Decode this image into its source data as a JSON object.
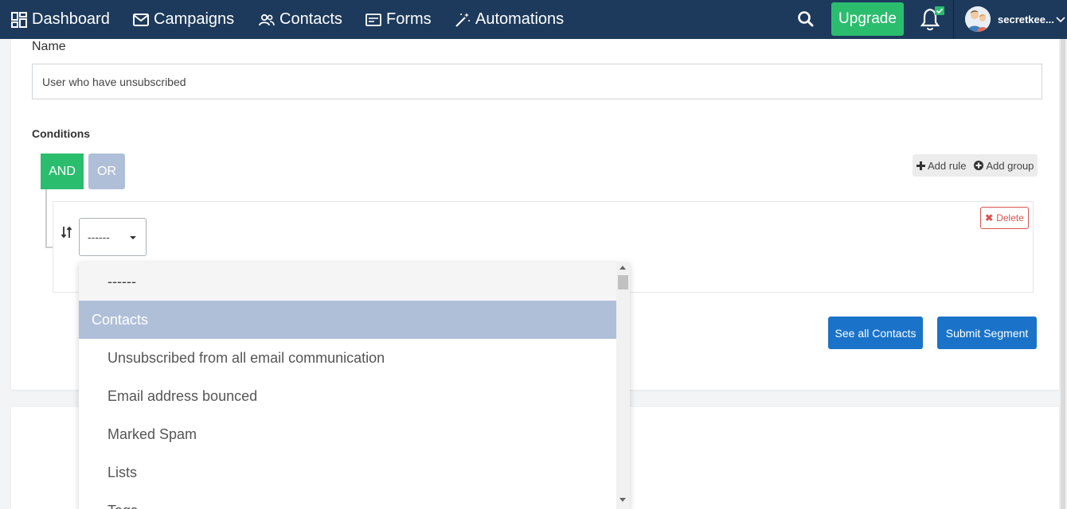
{
  "colors": {
    "nav_bg": "#1d3a5c",
    "upgrade_bg": "#2bbd6e",
    "and_bg": "#2bbd6e",
    "or_bg": "#b0bfd8",
    "primary_button": "#1a73c9",
    "delete_red": "#d9534f",
    "dropdown_group_bg": "#b0bfd8"
  },
  "nav": {
    "items": [
      {
        "label": "Dashboard",
        "icon": "dashboard-icon"
      },
      {
        "label": "Campaigns",
        "icon": "envelope-icon"
      },
      {
        "label": "Contacts",
        "icon": "contacts-icon"
      },
      {
        "label": "Forms",
        "icon": "forms-icon"
      },
      {
        "label": "Automations",
        "icon": "magic-wand-icon"
      }
    ],
    "upgrade_label": "Upgrade",
    "user_name": "secretkee..."
  },
  "form": {
    "name_label": "Name",
    "name_value": "User who have unsubscribed",
    "conditions_label": "Conditions",
    "and_label": "AND",
    "or_label": "OR",
    "add_rule_label": "Add rule",
    "add_group_label": "Add group",
    "select_value": "------",
    "delete_label": "Delete",
    "see_all_label": "See all Contacts",
    "submit_label": "Submit Segment"
  },
  "dropdown": {
    "empty_option": "------",
    "group_label": "Contacts",
    "options": [
      "Unsubscribed from all email communication",
      "Email address bounced",
      "Marked Spam",
      "Lists",
      "Tags"
    ]
  }
}
